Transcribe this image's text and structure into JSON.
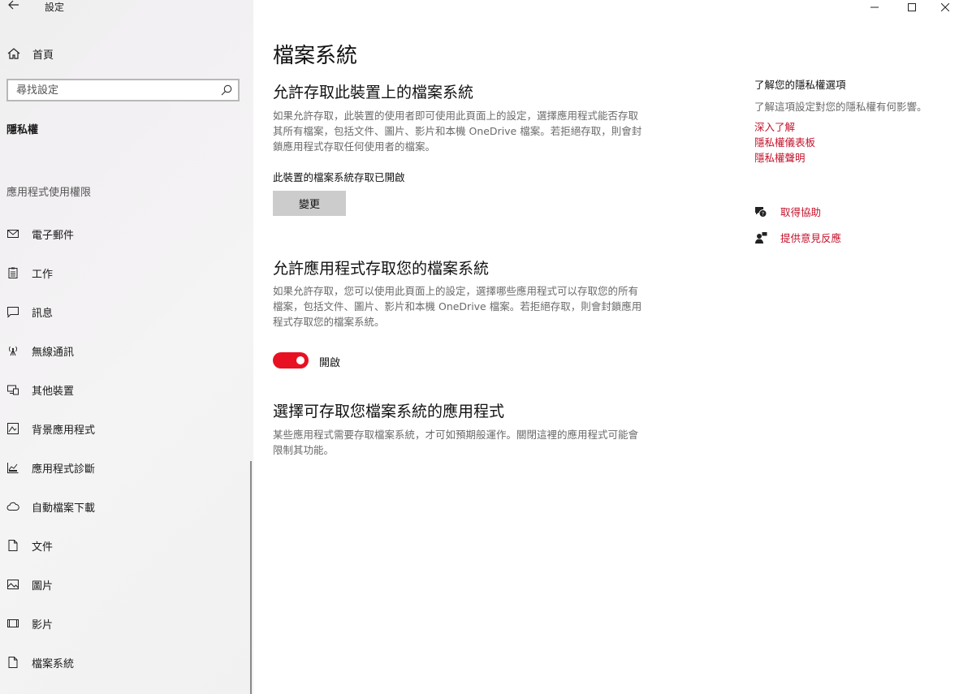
{
  "window": {
    "title": "設定"
  },
  "sidebar": {
    "home_label": "首頁",
    "search_placeholder": "尋找設定",
    "section": "隱私權",
    "group_label": "應用程式使用權限",
    "items": [
      {
        "label": "電子郵件",
        "icon": "mail-icon"
      },
      {
        "label": "工作",
        "icon": "clipboard-icon"
      },
      {
        "label": "訊息",
        "icon": "chat-icon"
      },
      {
        "label": "無線通訊",
        "icon": "antenna-icon"
      },
      {
        "label": "其他裝置",
        "icon": "devices-icon"
      },
      {
        "label": "背景應用程式",
        "icon": "background-apps-icon"
      },
      {
        "label": "應用程式診斷",
        "icon": "diagnostics-icon"
      },
      {
        "label": "自動檔案下載",
        "icon": "cloud-icon"
      },
      {
        "label": "文件",
        "icon": "document-icon"
      },
      {
        "label": "圖片",
        "icon": "picture-icon"
      },
      {
        "label": "影片",
        "icon": "video-icon"
      },
      {
        "label": "檔案系統",
        "icon": "file-system-icon"
      }
    ]
  },
  "main": {
    "title": "檔案系統",
    "section1": {
      "heading": "允許存取此裝置上的檔案系統",
      "description": "如果允許存取，此裝置的使用者即可使用此頁面上的設定，選擇應用程式能否存取其所有檔案，包括文件、圖片、影片和本機 OneDrive 檔案。若拒絕存取，則會封鎖應用程式存取任何使用者的檔案。",
      "status": "此裝置的檔案系統存取已開啟",
      "button": "變更"
    },
    "section2": {
      "heading": "允許應用程式存取您的檔案系統",
      "description": "如果允許存取，您可以使用此頁面上的設定，選擇哪些應用程式可以存取您的所有檔案，包括文件、圖片、影片和本機 OneDrive 檔案。若拒絕存取，則會封鎖應用程式存取您的檔案系統。",
      "toggle_label": "開啟",
      "toggle_on": true
    },
    "section3": {
      "heading": "選擇可存取您檔案系統的應用程式",
      "description": "某些應用程式需要存取檔案系統，才可如預期般運作。關閉這裡的應用程式可能會限制其功能。"
    }
  },
  "right": {
    "heading": "了解您的隱私權選項",
    "subtext": "了解這項設定對您的隱私權有何影響。",
    "links": [
      "深入了解",
      "隱私權儀表板",
      "隱私權聲明"
    ],
    "help": "取得協助",
    "feedback": "提供意見反應"
  },
  "colors": {
    "accent": "#e81123",
    "link": "#c4122b"
  }
}
